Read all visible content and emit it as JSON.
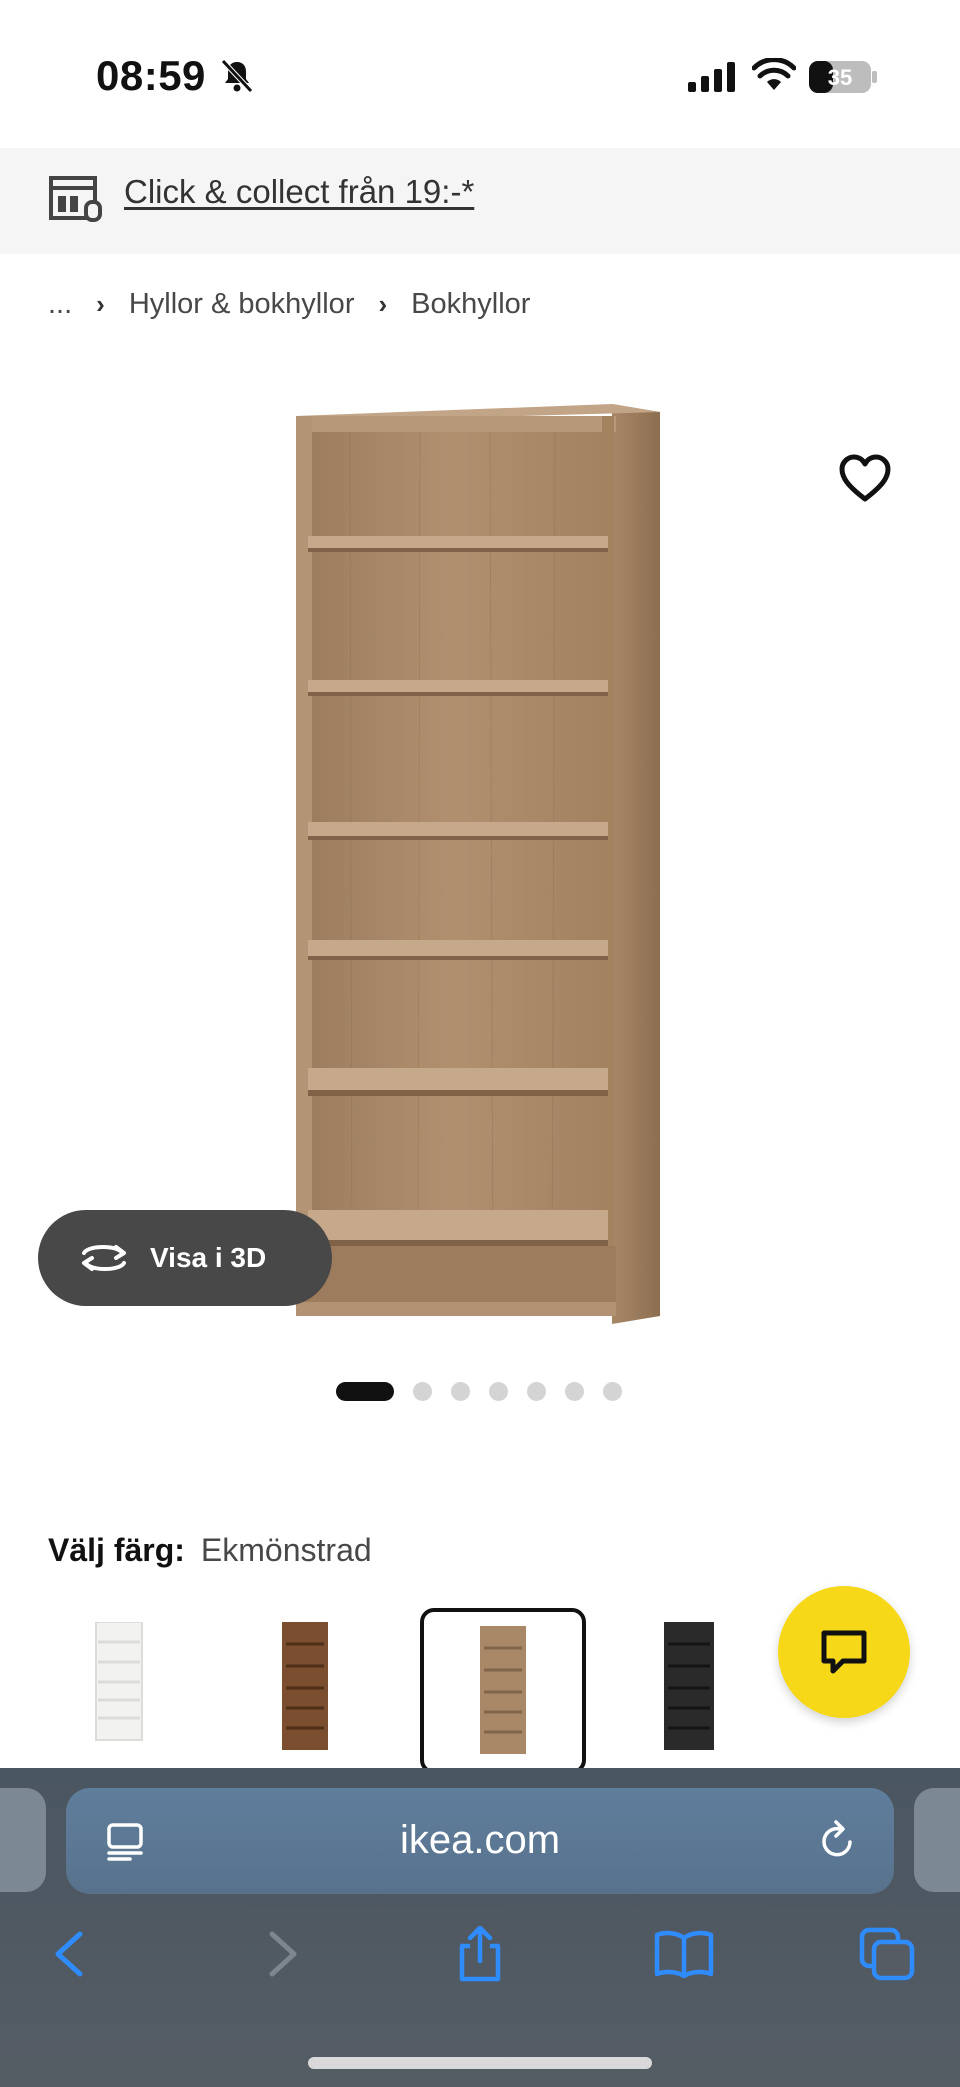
{
  "status_bar": {
    "time": "08:59",
    "battery": "35"
  },
  "banner": {
    "collect_text": "Click & collect från 19:-*"
  },
  "breadcrumb": {
    "items": [
      "...",
      "Hyllor & bokhyllor",
      "Bokhyllor"
    ]
  },
  "gallery": {
    "view_3d_label": "Visa i 3D",
    "image_count": 7,
    "active_index": 0
  },
  "color_selector": {
    "label": "Välj färg:",
    "selected_value": "Ekmönstrad",
    "options": [
      {
        "color": "#f2f2f0",
        "shelf": "#dcdcd8"
      },
      {
        "color": "#7a4e2e",
        "shelf": "#4e2f18"
      },
      {
        "color": "#a98868",
        "shelf": "#80654a"
      },
      {
        "color": "#2a2a2a",
        "shelf": "#141414"
      }
    ],
    "selected_index": 2
  },
  "colors": {
    "chat_button": "#f6d819",
    "accent_blue": "#2f8cff",
    "banner_bg": "#f5f5f5"
  },
  "browser": {
    "url": "ikea.com"
  }
}
